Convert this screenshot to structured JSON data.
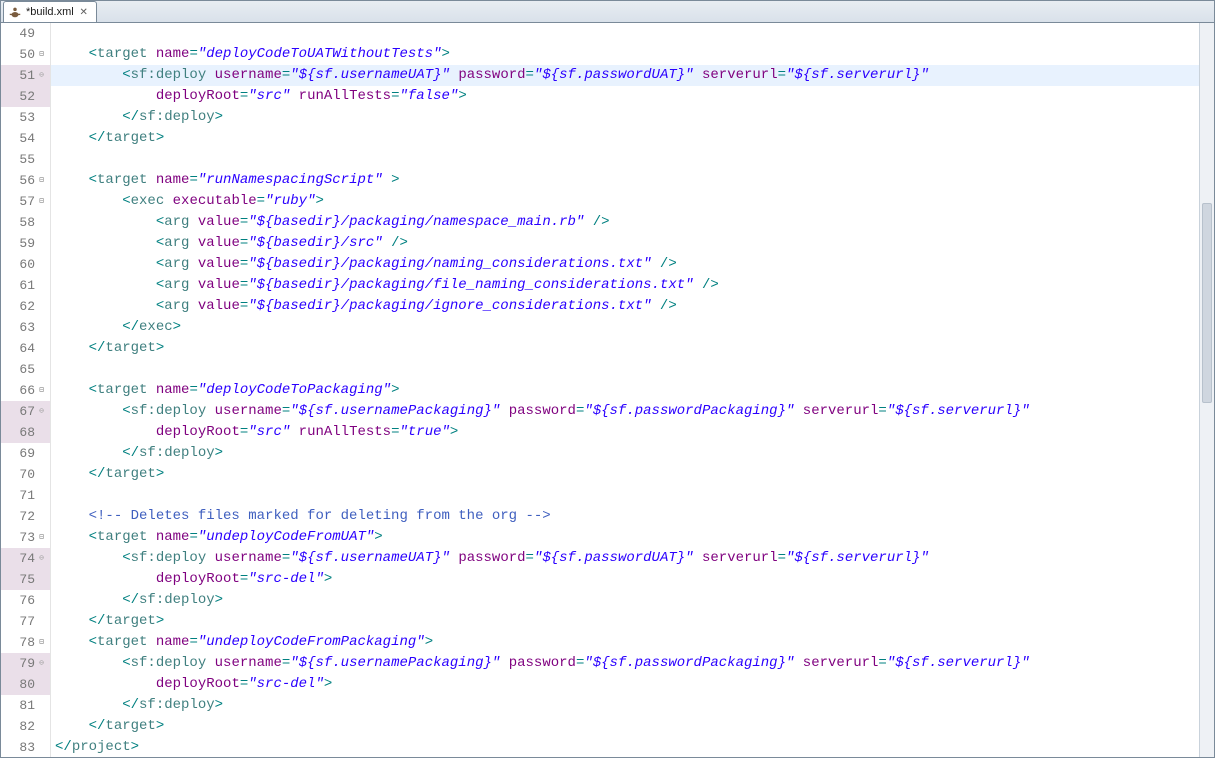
{
  "tab": {
    "title": "*build.xml"
  },
  "lines": [
    {
      "n": 49,
      "fold": "",
      "diff": false,
      "hl": false,
      "segs": []
    },
    {
      "n": 50,
      "fold": "minus",
      "diff": false,
      "hl": false,
      "segs": [
        {
          "t": "    ",
          "c": ""
        },
        {
          "t": "<",
          "c": "t-punc"
        },
        {
          "t": "target ",
          "c": "t-tag"
        },
        {
          "t": "name",
          "c": "t-attr"
        },
        {
          "t": "=",
          "c": "t-punc"
        },
        {
          "t": "\"deployCodeToUATWithoutTests\"",
          "c": "t-str"
        },
        {
          "t": ">",
          "c": "t-punc"
        }
      ]
    },
    {
      "n": 51,
      "fold": "circle-minus",
      "diff": true,
      "hl": true,
      "segs": [
        {
          "t": "        ",
          "c": ""
        },
        {
          "t": "<",
          "c": "t-punc"
        },
        {
          "t": "sf:deploy ",
          "c": "t-tag"
        },
        {
          "t": "username",
          "c": "t-attr"
        },
        {
          "t": "=",
          "c": "t-punc"
        },
        {
          "t": "\"${sf.usernameUAT}\"",
          "c": "t-str"
        },
        {
          "t": " ",
          "c": ""
        },
        {
          "t": "password",
          "c": "t-attr"
        },
        {
          "t": "=",
          "c": "t-punc"
        },
        {
          "t": "\"${sf.passwordUAT}\"",
          "c": "t-str"
        },
        {
          "t": " ",
          "c": ""
        },
        {
          "t": "serverurl",
          "c": "t-attr"
        },
        {
          "t": "=",
          "c": "t-punc"
        },
        {
          "t": "\"${sf.serverurl}\"",
          "c": "t-str"
        }
      ]
    },
    {
      "n": 52,
      "fold": "",
      "diff": true,
      "hl": false,
      "segs": [
        {
          "t": "            ",
          "c": ""
        },
        {
          "t": "deployRoot",
          "c": "t-attr"
        },
        {
          "t": "=",
          "c": "t-punc"
        },
        {
          "t": "\"src\"",
          "c": "t-str"
        },
        {
          "t": " ",
          "c": ""
        },
        {
          "t": "runAllTests",
          "c": "t-attr"
        },
        {
          "t": "=",
          "c": "t-punc"
        },
        {
          "t": "\"false\"",
          "c": "t-str"
        },
        {
          "t": ">",
          "c": "t-punc"
        }
      ]
    },
    {
      "n": 53,
      "fold": "",
      "diff": false,
      "hl": false,
      "segs": [
        {
          "t": "        ",
          "c": ""
        },
        {
          "t": "</",
          "c": "t-punc"
        },
        {
          "t": "sf:deploy",
          "c": "t-tag"
        },
        {
          "t": ">",
          "c": "t-punc"
        }
      ]
    },
    {
      "n": 54,
      "fold": "",
      "diff": false,
      "hl": false,
      "segs": [
        {
          "t": "    ",
          "c": ""
        },
        {
          "t": "</",
          "c": "t-punc"
        },
        {
          "t": "target",
          "c": "t-tag"
        },
        {
          "t": ">",
          "c": "t-punc"
        }
      ]
    },
    {
      "n": 55,
      "fold": "",
      "diff": false,
      "hl": false,
      "segs": []
    },
    {
      "n": 56,
      "fold": "minus",
      "diff": false,
      "hl": false,
      "segs": [
        {
          "t": "    ",
          "c": ""
        },
        {
          "t": "<",
          "c": "t-punc"
        },
        {
          "t": "target ",
          "c": "t-tag"
        },
        {
          "t": "name",
          "c": "t-attr"
        },
        {
          "t": "=",
          "c": "t-punc"
        },
        {
          "t": "\"runNamespacingScript\"",
          "c": "t-str"
        },
        {
          "t": " >",
          "c": "t-punc"
        }
      ]
    },
    {
      "n": 57,
      "fold": "minus",
      "diff": false,
      "hl": false,
      "segs": [
        {
          "t": "        ",
          "c": ""
        },
        {
          "t": "<",
          "c": "t-punc"
        },
        {
          "t": "exec ",
          "c": "t-tag"
        },
        {
          "t": "executable",
          "c": "t-attr"
        },
        {
          "t": "=",
          "c": "t-punc"
        },
        {
          "t": "\"ruby\"",
          "c": "t-str"
        },
        {
          "t": ">",
          "c": "t-punc"
        }
      ]
    },
    {
      "n": 58,
      "fold": "",
      "diff": false,
      "hl": false,
      "segs": [
        {
          "t": "            ",
          "c": ""
        },
        {
          "t": "<",
          "c": "t-punc"
        },
        {
          "t": "arg ",
          "c": "t-tag"
        },
        {
          "t": "value",
          "c": "t-attr"
        },
        {
          "t": "=",
          "c": "t-punc"
        },
        {
          "t": "\"${basedir}/packaging/namespace_main.rb\"",
          "c": "t-str"
        },
        {
          "t": " />",
          "c": "t-punc"
        }
      ]
    },
    {
      "n": 59,
      "fold": "",
      "diff": false,
      "hl": false,
      "segs": [
        {
          "t": "            ",
          "c": ""
        },
        {
          "t": "<",
          "c": "t-punc"
        },
        {
          "t": "arg ",
          "c": "t-tag"
        },
        {
          "t": "value",
          "c": "t-attr"
        },
        {
          "t": "=",
          "c": "t-punc"
        },
        {
          "t": "\"${basedir}/src\"",
          "c": "t-str"
        },
        {
          "t": " />",
          "c": "t-punc"
        }
      ]
    },
    {
      "n": 60,
      "fold": "",
      "diff": false,
      "hl": false,
      "segs": [
        {
          "t": "            ",
          "c": ""
        },
        {
          "t": "<",
          "c": "t-punc"
        },
        {
          "t": "arg ",
          "c": "t-tag"
        },
        {
          "t": "value",
          "c": "t-attr"
        },
        {
          "t": "=",
          "c": "t-punc"
        },
        {
          "t": "\"${basedir}/packaging/naming_considerations.txt\"",
          "c": "t-str"
        },
        {
          "t": " />",
          "c": "t-punc"
        }
      ]
    },
    {
      "n": 61,
      "fold": "",
      "diff": false,
      "hl": false,
      "segs": [
        {
          "t": "            ",
          "c": ""
        },
        {
          "t": "<",
          "c": "t-punc"
        },
        {
          "t": "arg ",
          "c": "t-tag"
        },
        {
          "t": "value",
          "c": "t-attr"
        },
        {
          "t": "=",
          "c": "t-punc"
        },
        {
          "t": "\"${basedir}/packaging/file_naming_considerations.txt\"",
          "c": "t-str"
        },
        {
          "t": " />",
          "c": "t-punc"
        }
      ]
    },
    {
      "n": 62,
      "fold": "",
      "diff": false,
      "hl": false,
      "segs": [
        {
          "t": "            ",
          "c": ""
        },
        {
          "t": "<",
          "c": "t-punc"
        },
        {
          "t": "arg ",
          "c": "t-tag"
        },
        {
          "t": "value",
          "c": "t-attr"
        },
        {
          "t": "=",
          "c": "t-punc"
        },
        {
          "t": "\"${basedir}/packaging/ignore_considerations.txt\"",
          "c": "t-str"
        },
        {
          "t": " />",
          "c": "t-punc"
        }
      ]
    },
    {
      "n": 63,
      "fold": "",
      "diff": false,
      "hl": false,
      "segs": [
        {
          "t": "        ",
          "c": ""
        },
        {
          "t": "</",
          "c": "t-punc"
        },
        {
          "t": "exec",
          "c": "t-tag"
        },
        {
          "t": ">",
          "c": "t-punc"
        }
      ]
    },
    {
      "n": 64,
      "fold": "",
      "diff": false,
      "hl": false,
      "segs": [
        {
          "t": "    ",
          "c": ""
        },
        {
          "t": "</",
          "c": "t-punc"
        },
        {
          "t": "target",
          "c": "t-tag"
        },
        {
          "t": ">",
          "c": "t-punc"
        }
      ]
    },
    {
      "n": 65,
      "fold": "",
      "diff": false,
      "hl": false,
      "segs": []
    },
    {
      "n": 66,
      "fold": "minus",
      "diff": false,
      "hl": false,
      "segs": [
        {
          "t": "    ",
          "c": ""
        },
        {
          "t": "<",
          "c": "t-punc"
        },
        {
          "t": "target ",
          "c": "t-tag"
        },
        {
          "t": "name",
          "c": "t-attr"
        },
        {
          "t": "=",
          "c": "t-punc"
        },
        {
          "t": "\"deployCodeToPackaging\"",
          "c": "t-str"
        },
        {
          "t": ">",
          "c": "t-punc"
        }
      ]
    },
    {
      "n": 67,
      "fold": "circle-minus",
      "diff": true,
      "hl": false,
      "segs": [
        {
          "t": "        ",
          "c": ""
        },
        {
          "t": "<",
          "c": "t-punc"
        },
        {
          "t": "sf:deploy ",
          "c": "t-tag"
        },
        {
          "t": "username",
          "c": "t-attr"
        },
        {
          "t": "=",
          "c": "t-punc"
        },
        {
          "t": "\"${sf.usernamePackaging}\"",
          "c": "t-str"
        },
        {
          "t": " ",
          "c": ""
        },
        {
          "t": "password",
          "c": "t-attr"
        },
        {
          "t": "=",
          "c": "t-punc"
        },
        {
          "t": "\"${sf.passwordPackaging}\"",
          "c": "t-str"
        },
        {
          "t": " ",
          "c": ""
        },
        {
          "t": "serverurl",
          "c": "t-attr"
        },
        {
          "t": "=",
          "c": "t-punc"
        },
        {
          "t": "\"${sf.serverurl}\"",
          "c": "t-str"
        }
      ]
    },
    {
      "n": 68,
      "fold": "",
      "diff": true,
      "hl": false,
      "segs": [
        {
          "t": "            ",
          "c": ""
        },
        {
          "t": "deployRoot",
          "c": "t-attr"
        },
        {
          "t": "=",
          "c": "t-punc"
        },
        {
          "t": "\"src\"",
          "c": "t-str"
        },
        {
          "t": " ",
          "c": ""
        },
        {
          "t": "runAllTests",
          "c": "t-attr"
        },
        {
          "t": "=",
          "c": "t-punc"
        },
        {
          "t": "\"true\"",
          "c": "t-str"
        },
        {
          "t": ">",
          "c": "t-punc"
        }
      ]
    },
    {
      "n": 69,
      "fold": "",
      "diff": false,
      "hl": false,
      "segs": [
        {
          "t": "        ",
          "c": ""
        },
        {
          "t": "</",
          "c": "t-punc"
        },
        {
          "t": "sf:deploy",
          "c": "t-tag"
        },
        {
          "t": ">",
          "c": "t-punc"
        }
      ]
    },
    {
      "n": 70,
      "fold": "",
      "diff": false,
      "hl": false,
      "segs": [
        {
          "t": "    ",
          "c": ""
        },
        {
          "t": "</",
          "c": "t-punc"
        },
        {
          "t": "target",
          "c": "t-tag"
        },
        {
          "t": ">",
          "c": "t-punc"
        }
      ]
    },
    {
      "n": 71,
      "fold": "",
      "diff": false,
      "hl": false,
      "segs": []
    },
    {
      "n": 72,
      "fold": "",
      "diff": false,
      "hl": false,
      "segs": [
        {
          "t": "    ",
          "c": ""
        },
        {
          "t": "<!-- Deletes files marked for deleting from the org -->",
          "c": "t-comment"
        }
      ]
    },
    {
      "n": 73,
      "fold": "minus",
      "diff": false,
      "hl": false,
      "segs": [
        {
          "t": "    ",
          "c": ""
        },
        {
          "t": "<",
          "c": "t-punc"
        },
        {
          "t": "target ",
          "c": "t-tag"
        },
        {
          "t": "name",
          "c": "t-attr"
        },
        {
          "t": "=",
          "c": "t-punc"
        },
        {
          "t": "\"undeployCodeFromUAT\"",
          "c": "t-str"
        },
        {
          "t": ">",
          "c": "t-punc"
        }
      ]
    },
    {
      "n": 74,
      "fold": "circle-minus",
      "diff": true,
      "hl": false,
      "segs": [
        {
          "t": "        ",
          "c": ""
        },
        {
          "t": "<",
          "c": "t-punc"
        },
        {
          "t": "sf:deploy ",
          "c": "t-tag"
        },
        {
          "t": "username",
          "c": "t-attr"
        },
        {
          "t": "=",
          "c": "t-punc"
        },
        {
          "t": "\"${sf.usernameUAT}\"",
          "c": "t-str"
        },
        {
          "t": " ",
          "c": ""
        },
        {
          "t": "password",
          "c": "t-attr"
        },
        {
          "t": "=",
          "c": "t-punc"
        },
        {
          "t": "\"${sf.passwordUAT}\"",
          "c": "t-str"
        },
        {
          "t": " ",
          "c": ""
        },
        {
          "t": "serverurl",
          "c": "t-attr"
        },
        {
          "t": "=",
          "c": "t-punc"
        },
        {
          "t": "\"${sf.serverurl}\"",
          "c": "t-str"
        }
      ]
    },
    {
      "n": 75,
      "fold": "",
      "diff": true,
      "hl": false,
      "segs": [
        {
          "t": "            ",
          "c": ""
        },
        {
          "t": "deployRoot",
          "c": "t-attr"
        },
        {
          "t": "=",
          "c": "t-punc"
        },
        {
          "t": "\"src-del\"",
          "c": "t-str"
        },
        {
          "t": ">",
          "c": "t-punc"
        }
      ]
    },
    {
      "n": 76,
      "fold": "",
      "diff": false,
      "hl": false,
      "segs": [
        {
          "t": "        ",
          "c": ""
        },
        {
          "t": "</",
          "c": "t-punc"
        },
        {
          "t": "sf:deploy",
          "c": "t-tag"
        },
        {
          "t": ">",
          "c": "t-punc"
        }
      ]
    },
    {
      "n": 77,
      "fold": "",
      "diff": false,
      "hl": false,
      "segs": [
        {
          "t": "    ",
          "c": ""
        },
        {
          "t": "</",
          "c": "t-punc"
        },
        {
          "t": "target",
          "c": "t-tag"
        },
        {
          "t": ">",
          "c": "t-punc"
        }
      ]
    },
    {
      "n": 78,
      "fold": "minus",
      "diff": false,
      "hl": false,
      "segs": [
        {
          "t": "    ",
          "c": ""
        },
        {
          "t": "<",
          "c": "t-punc"
        },
        {
          "t": "target ",
          "c": "t-tag"
        },
        {
          "t": "name",
          "c": "t-attr"
        },
        {
          "t": "=",
          "c": "t-punc"
        },
        {
          "t": "\"undeployCodeFromPackaging\"",
          "c": "t-str"
        },
        {
          "t": ">",
          "c": "t-punc"
        }
      ]
    },
    {
      "n": 79,
      "fold": "circle-minus",
      "diff": true,
      "hl": false,
      "segs": [
        {
          "t": "        ",
          "c": ""
        },
        {
          "t": "<",
          "c": "t-punc"
        },
        {
          "t": "sf:deploy ",
          "c": "t-tag"
        },
        {
          "t": "username",
          "c": "t-attr"
        },
        {
          "t": "=",
          "c": "t-punc"
        },
        {
          "t": "\"${sf.usernamePackaging}\"",
          "c": "t-str"
        },
        {
          "t": " ",
          "c": ""
        },
        {
          "t": "password",
          "c": "t-attr"
        },
        {
          "t": "=",
          "c": "t-punc"
        },
        {
          "t": "\"${sf.passwordPackaging}\"",
          "c": "t-str"
        },
        {
          "t": " ",
          "c": ""
        },
        {
          "t": "serverurl",
          "c": "t-attr"
        },
        {
          "t": "=",
          "c": "t-punc"
        },
        {
          "t": "\"${sf.serverurl}\"",
          "c": "t-str"
        }
      ]
    },
    {
      "n": 80,
      "fold": "",
      "diff": true,
      "hl": false,
      "segs": [
        {
          "t": "            ",
          "c": ""
        },
        {
          "t": "deployRoot",
          "c": "t-attr"
        },
        {
          "t": "=",
          "c": "t-punc"
        },
        {
          "t": "\"src-del\"",
          "c": "t-str"
        },
        {
          "t": ">",
          "c": "t-punc"
        }
      ]
    },
    {
      "n": 81,
      "fold": "",
      "diff": false,
      "hl": false,
      "segs": [
        {
          "t": "        ",
          "c": ""
        },
        {
          "t": "</",
          "c": "t-punc"
        },
        {
          "t": "sf:deploy",
          "c": "t-tag"
        },
        {
          "t": ">",
          "c": "t-punc"
        }
      ]
    },
    {
      "n": 82,
      "fold": "",
      "diff": false,
      "hl": false,
      "segs": [
        {
          "t": "    ",
          "c": ""
        },
        {
          "t": "</",
          "c": "t-punc"
        },
        {
          "t": "target",
          "c": "t-tag"
        },
        {
          "t": ">",
          "c": "t-punc"
        }
      ]
    },
    {
      "n": 83,
      "fold": "",
      "diff": false,
      "hl": false,
      "segs": [
        {
          "t": "</",
          "c": "t-punc"
        },
        {
          "t": "project",
          "c": "t-tag"
        },
        {
          "t": ">",
          "c": "t-punc"
        }
      ]
    }
  ]
}
